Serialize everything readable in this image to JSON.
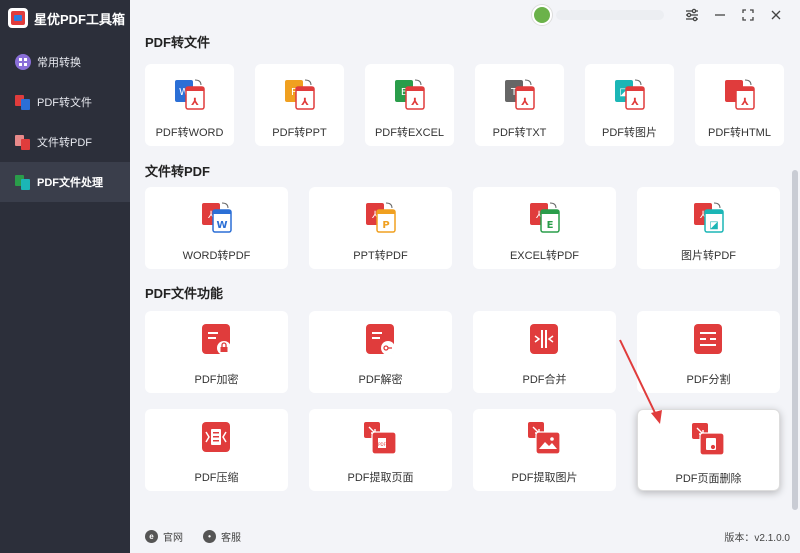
{
  "app": {
    "title": "星优PDF工具箱"
  },
  "sidebar": {
    "items": [
      {
        "label": "常用转换",
        "icon": "grid-icon",
        "active": false
      },
      {
        "label": "PDF转文件",
        "icon": "pdf-to-file-icon",
        "active": false
      },
      {
        "label": "文件转PDF",
        "icon": "file-to-pdf-icon",
        "active": false
      },
      {
        "label": "PDF文件处理",
        "icon": "pdf-process-icon",
        "active": true
      }
    ]
  },
  "titlebar": {
    "settings_icon": "sliders-icon",
    "minimize_icon": "minimize-icon",
    "maximize_icon": "maximize-icon",
    "close_icon": "close-icon"
  },
  "sections": {
    "pdf_to_file": {
      "title": "PDF转文件",
      "items": [
        {
          "label": "PDF转WORD",
          "badge": "W",
          "color": "#2b6fd6"
        },
        {
          "label": "PDF转PPT",
          "badge": "P",
          "color": "#f0a020"
        },
        {
          "label": "PDF转EXCEL",
          "badge": "E",
          "color": "#2a9d4a"
        },
        {
          "label": "PDF转TXT",
          "badge": "T",
          "color": "#666666"
        },
        {
          "label": "PDF转图片",
          "badge": "img",
          "color": "#1bb6b6"
        },
        {
          "label": "PDF转HTML",
          "badge": "</>",
          "color": "#e03c3c"
        }
      ]
    },
    "file_to_pdf": {
      "title": "文件转PDF",
      "items": [
        {
          "label": "WORD转PDF",
          "badge": "W",
          "color": "#2b6fd6"
        },
        {
          "label": "PPT转PDF",
          "badge": "P",
          "color": "#f0a020"
        },
        {
          "label": "EXCEL转PDF",
          "badge": "E",
          "color": "#2a9d4a"
        },
        {
          "label": "图片转PDF",
          "badge": "img",
          "color": "#1bb6b6"
        }
      ]
    },
    "pdf_functions": {
      "title": "PDF文件功能",
      "items": [
        {
          "label": "PDF加密",
          "icon": "pdf-lock-icon"
        },
        {
          "label": "PDF解密",
          "icon": "pdf-key-icon"
        },
        {
          "label": "PDF合并",
          "icon": "pdf-merge-icon"
        },
        {
          "label": "PDF分割",
          "icon": "pdf-split-icon"
        },
        {
          "label": "PDF压缩",
          "icon": "pdf-compress-icon"
        },
        {
          "label": "PDF提取页面",
          "icon": "pdf-extract-page-icon"
        },
        {
          "label": "PDF提取图片",
          "icon": "pdf-extract-image-icon"
        },
        {
          "label": "PDF页面删除",
          "icon": "pdf-delete-page-icon"
        }
      ]
    }
  },
  "footer": {
    "website_label": "官网",
    "support_label": "客服",
    "version": "版本：v2.1.0.0"
  },
  "colors": {
    "sidebar_bg": "#2c2f3a",
    "accent_red": "#e03c3c",
    "content_bg": "#f3f4f8"
  }
}
